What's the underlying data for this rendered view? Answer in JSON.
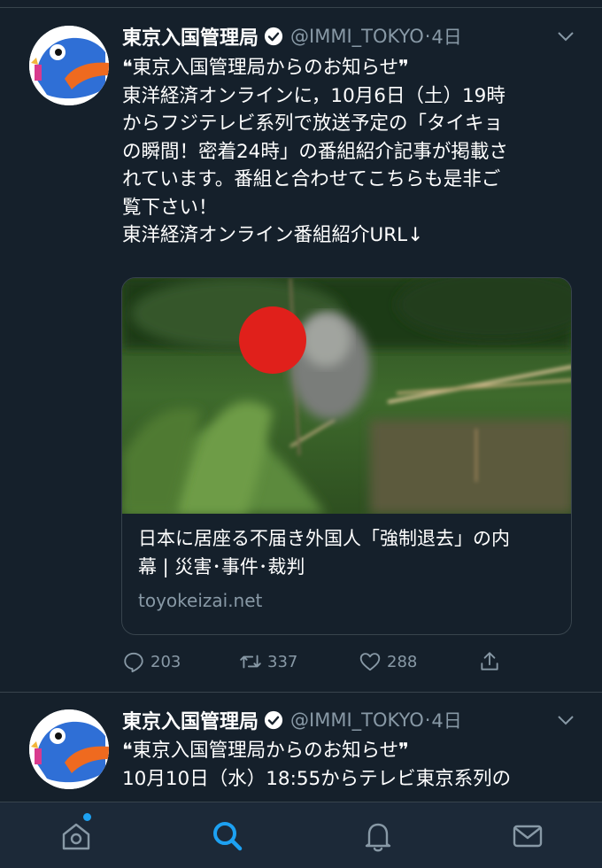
{
  "tweets": [
    {
      "name": "東京入国管理局",
      "handle": "@IMMI_TOKYO",
      "dot": "·",
      "time": "4日",
      "lines": [
        "❝東京入国管理局からのお知らせ❞",
        "東洋経済オンラインに，10月6日（土）19時",
        "からフジテレビ系列で放送予定の「タイキョ",
        "の瞬間！密着24時」の番組紹介記事が掲載さ",
        "れています。番組と合わせてこちらも是非ご",
        "覧下さい！",
        "東洋経済オンライン番組紹介URL↓"
      ],
      "card": {
        "title_lines": [
          "日本に居座る不届き外国人「強制退去」の内",
          "幕 | 災害･事件･裁判"
        ],
        "domain": "toyokeizai.net"
      },
      "actions": {
        "replies": "203",
        "retweets": "337",
        "likes": "288"
      }
    },
    {
      "name": "東京入国管理局",
      "handle": "@IMMI_TOKYO",
      "dot": "·",
      "time": "4日",
      "lines": [
        "❝東京入国管理局からのお知らせ❞",
        "10月10日（水）18:55からテレビ東京系列の"
      ]
    }
  ],
  "tabbar": {
    "items": [
      "home-icon",
      "search-icon",
      "notifications-icon",
      "messages-icon"
    ],
    "active": "search-icon"
  },
  "colors": {
    "background": "#15202b",
    "text": "#ffffff",
    "muted": "#8899a6",
    "accent": "#1da1f2",
    "border": "#38444d"
  }
}
